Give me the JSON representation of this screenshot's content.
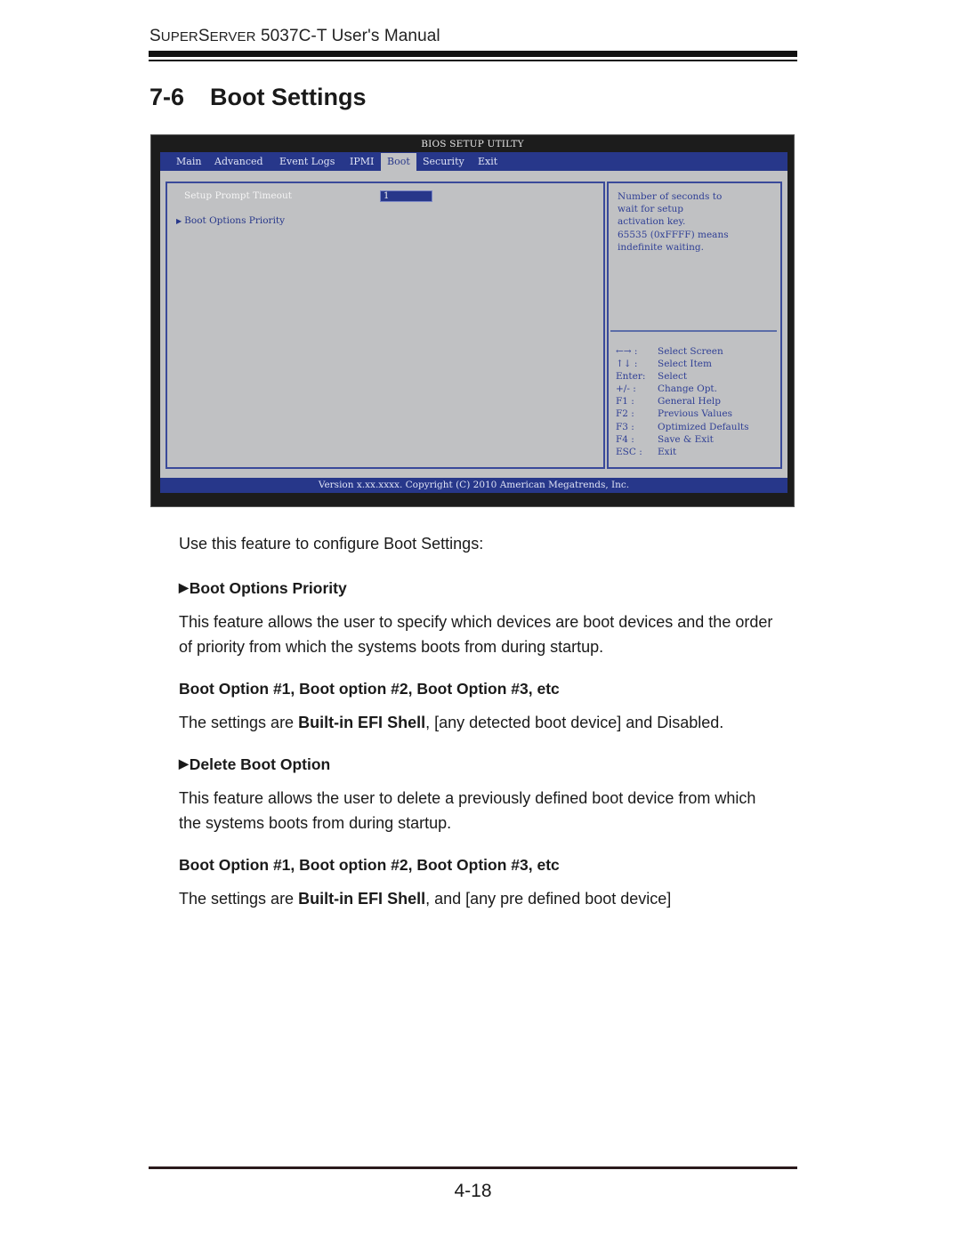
{
  "header": {
    "manual_title_prefix_big": "S",
    "manual_title_prefix_small": "UPER",
    "manual_title_mid_big": "S",
    "manual_title_mid_small": "ERVER",
    "manual_title_rest": " 5037C-T User's Manual"
  },
  "section": {
    "number": "7-6",
    "title": "Boot Settings"
  },
  "bios": {
    "title": "BIOS SETUP UTILTY",
    "tabs": [
      {
        "label": "Main",
        "active": false
      },
      {
        "label": "Advanced",
        "active": false
      },
      {
        "label": "Event Logs",
        "active": false
      },
      {
        "label": "IPMI",
        "active": false
      },
      {
        "label": "Boot",
        "active": true
      },
      {
        "label": "Security",
        "active": false
      },
      {
        "label": "Exit",
        "active": false
      }
    ],
    "options": [
      {
        "label": "Setup Prompt Timeout",
        "value": "1"
      }
    ],
    "submenus": [
      {
        "label": "Boot Options Priority",
        "icon": "triangle-right-icon"
      }
    ],
    "help_lines": [
      "Number of seconds to",
      "wait for setup",
      "activation key.",
      "65535 (0xFFFF) means",
      "indefinite waiting."
    ],
    "keys": [
      {
        "key": "←→ :",
        "action": "Select Screen"
      },
      {
        "key": "↑↓  :",
        "action": "Select Item"
      },
      {
        "key": "Enter:",
        "action": "Select"
      },
      {
        "key": "+/- :",
        "action": "Change Opt."
      },
      {
        "key": "F1 :",
        "action": "General Help"
      },
      {
        "key": "F2 :",
        "action": "Previous Values"
      },
      {
        "key": "F3 :",
        "action": "Optimized Defaults"
      },
      {
        "key": "F4 :",
        "action": "Save & Exit"
      },
      {
        "key": "ESC :",
        "action": "Exit"
      }
    ],
    "footer": "Version x.xx.xxxx. Copyright (C) 2010 American Megatrends, Inc.",
    "colors": {
      "menubar": "#27378a",
      "panel": "#c0c1c3",
      "frame": "#1c1c1c"
    }
  },
  "content": {
    "intro": "Use this feature to configure Boot Settings:",
    "blocks": [
      {
        "heading": "Boot Options Priority",
        "has_arrow": true,
        "body_line1": "This feature allows the user to specify which devices are boot devices and the order",
        "body_line2": "of priority from which the systems boots from during startup.",
        "sub_heading": "Boot Option #1, Boot option #2, Boot Option #3, etc",
        "settings_prefix": "The settings are ",
        "settings_bold": "Built-in EFI Shell",
        "settings_suffix": ", [any detected boot device] and Disabled."
      },
      {
        "heading": "Delete Boot Option",
        "has_arrow": true,
        "body_line1": "This feature allows the user to delete a previously defined  boot device from which",
        "body_line2": "the systems boots from during startup.",
        "sub_heading": "Boot Option #1, Boot option #2, Boot Option #3, etc",
        "settings_prefix": "The settings are ",
        "settings_bold": "Built-in EFI Shell",
        "settings_suffix": ", and [any pre defined boot device]"
      }
    ]
  },
  "footer": {
    "page_number": "4-18"
  }
}
